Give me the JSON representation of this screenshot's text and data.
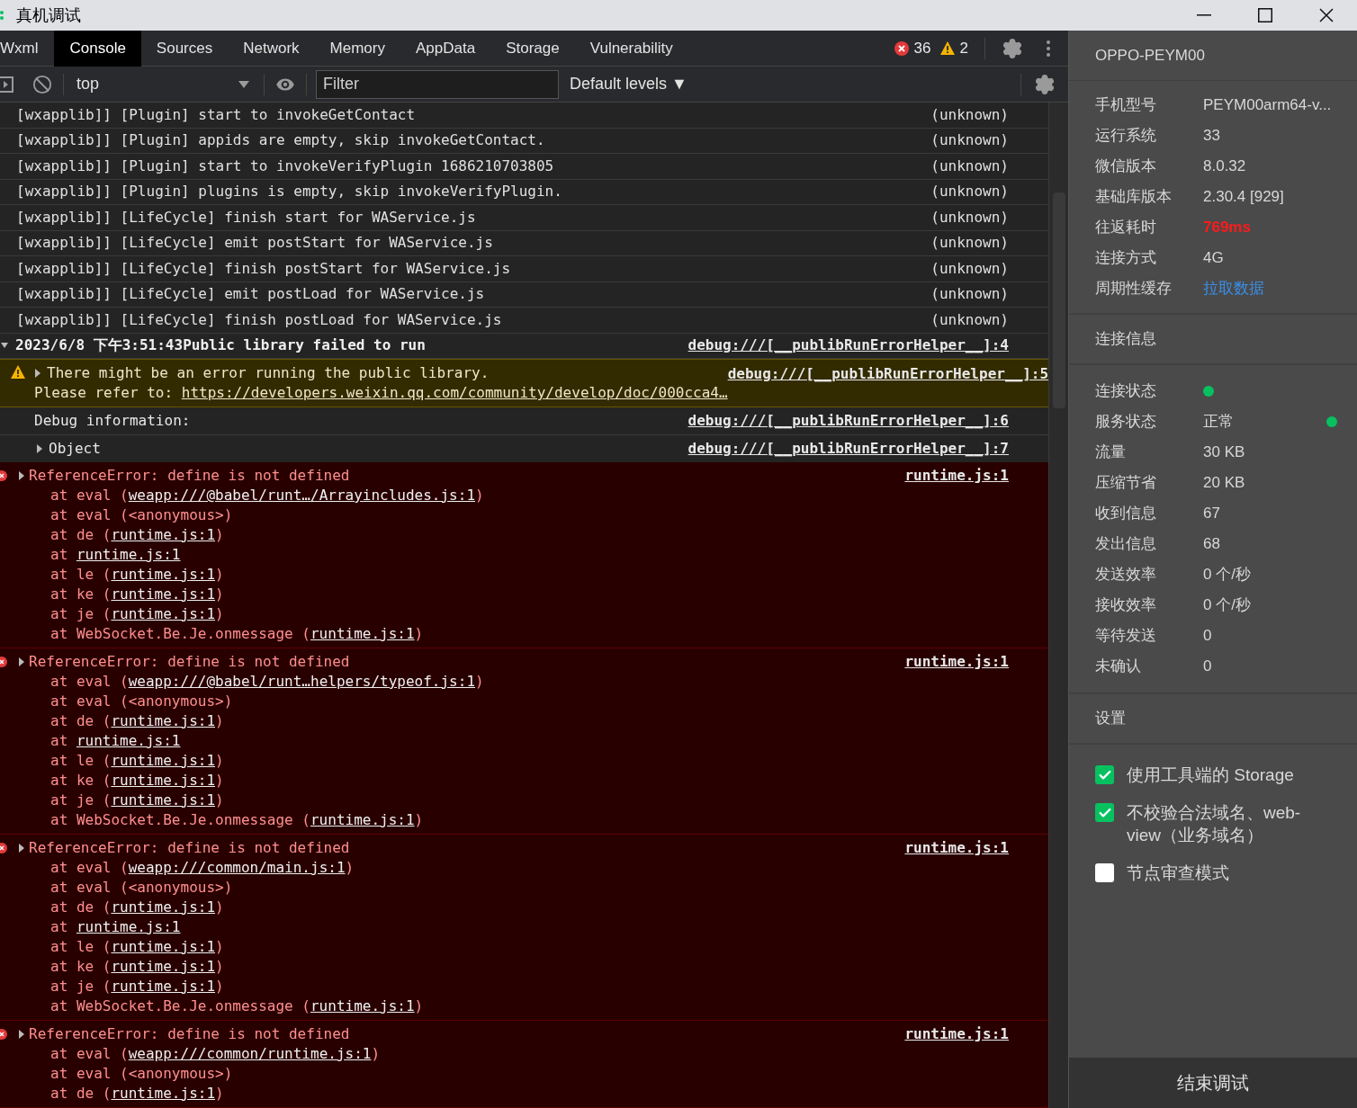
{
  "window": {
    "title": "真机调试"
  },
  "tabs": [
    {
      "label": "Wxml",
      "selected": false
    },
    {
      "label": "Console",
      "selected": true
    },
    {
      "label": "Sources",
      "selected": false
    },
    {
      "label": "Network",
      "selected": false
    },
    {
      "label": "Memory",
      "selected": false
    },
    {
      "label": "AppData",
      "selected": false
    },
    {
      "label": "Storage",
      "selected": false
    },
    {
      "label": "Vulnerability",
      "selected": false
    }
  ],
  "counts": {
    "errors": "36",
    "warnings": "2"
  },
  "console_toolbar": {
    "context": "top",
    "filter": {
      "placeholder": "Filter"
    },
    "levels": "Default levels",
    "levels_caret": "▼"
  },
  "logs": [
    {
      "kind": "plain",
      "text": "[wxapplib]] [Plugin] start to invokeGetContact",
      "source": "(unknown)"
    },
    {
      "kind": "plain",
      "text": "[wxapplib]] [Plugin] appids are empty, skip invokeGetContact.",
      "source": "(unknown)"
    },
    {
      "kind": "plain",
      "text": "[wxapplib]] [Plugin] start to invokeVerifyPlugin 1686210703805",
      "source": "(unknown)"
    },
    {
      "kind": "plain",
      "text": "[wxapplib]] [Plugin] plugins is empty, skip invokeVerifyPlugin.",
      "source": "(unknown)"
    },
    {
      "kind": "plain",
      "text": "[wxapplib]] [LifeCycle] finish start for WAService.js",
      "source": "(unknown)"
    },
    {
      "kind": "plain",
      "text": "[wxapplib]] [LifeCycle] emit postStart for WAService.js",
      "source": "(unknown)"
    },
    {
      "kind": "plain",
      "text": "[wxapplib]] [LifeCycle] finish postStart for WAService.js",
      "source": "(unknown)"
    },
    {
      "kind": "plain",
      "text": "[wxapplib]] [LifeCycle] emit postLoad for WAService.js",
      "source": "(unknown)"
    },
    {
      "kind": "plain",
      "text": "[wxapplib]] [LifeCycle] finish postLoad for WAService.js",
      "source": "(unknown)"
    },
    {
      "kind": "group",
      "text": "2023/6/8 下午3:51:43Public library failed to run",
      "source": "debug:///[__publibRunErrorHelper__]:4"
    },
    {
      "kind": "warning",
      "text": "There might be an error running the public library.",
      "prefix": "Please refer to: ",
      "link": "https://developers.weixin.qq.com/community/develop/doc/000cca4…",
      "source": "debug:///[__publibRunErrorHelper__]:5"
    },
    {
      "kind": "indent",
      "text": "Debug information:",
      "source": "debug:///[__publibRunErrorHelper__]:6"
    },
    {
      "kind": "object",
      "text": "Object",
      "source": "debug:///[__publibRunErrorHelper__]:7"
    }
  ],
  "errors": [
    {
      "message": "ReferenceError: define is not defined",
      "source": "runtime.js:1",
      "stack": [
        {
          "prefix": "at eval (",
          "link": "weapp:///@babel/runt…/Arrayincludes.js:1",
          "suffix": ")"
        },
        {
          "prefix": "at eval (<anonymous>)"
        },
        {
          "prefix": "at de (",
          "link": "runtime.js:1",
          "suffix": ")"
        },
        {
          "prefix": "at ",
          "link": "runtime.js:1"
        },
        {
          "prefix": "at le (",
          "link": "runtime.js:1",
          "suffix": ")"
        },
        {
          "prefix": "at ke (",
          "link": "runtime.js:1",
          "suffix": ")"
        },
        {
          "prefix": "at je (",
          "link": "runtime.js:1",
          "suffix": ")"
        },
        {
          "prefix": "at WebSocket.Be.Je.onmessage (",
          "link": "runtime.js:1",
          "suffix": ")"
        }
      ]
    },
    {
      "message": "ReferenceError: define is not defined",
      "source": "runtime.js:1",
      "stack": [
        {
          "prefix": "at eval (",
          "link": "weapp:///@babel/runt…helpers/typeof.js:1",
          "suffix": ")"
        },
        {
          "prefix": "at eval (<anonymous>)"
        },
        {
          "prefix": "at de (",
          "link": "runtime.js:1",
          "suffix": ")"
        },
        {
          "prefix": "at ",
          "link": "runtime.js:1"
        },
        {
          "prefix": "at le (",
          "link": "runtime.js:1",
          "suffix": ")"
        },
        {
          "prefix": "at ke (",
          "link": "runtime.js:1",
          "suffix": ")"
        },
        {
          "prefix": "at je (",
          "link": "runtime.js:1",
          "suffix": ")"
        },
        {
          "prefix": "at WebSocket.Be.Je.onmessage (",
          "link": "runtime.js:1",
          "suffix": ")"
        }
      ]
    },
    {
      "message": "ReferenceError: define is not defined",
      "source": "runtime.js:1",
      "stack": [
        {
          "prefix": "at eval (",
          "link": "weapp:///common/main.js:1",
          "suffix": ")"
        },
        {
          "prefix": "at eval (<anonymous>)"
        },
        {
          "prefix": "at de (",
          "link": "runtime.js:1",
          "suffix": ")"
        },
        {
          "prefix": "at ",
          "link": "runtime.js:1"
        },
        {
          "prefix": "at le (",
          "link": "runtime.js:1",
          "suffix": ")"
        },
        {
          "prefix": "at ke (",
          "link": "runtime.js:1",
          "suffix": ")"
        },
        {
          "prefix": "at je (",
          "link": "runtime.js:1",
          "suffix": ")"
        },
        {
          "prefix": "at WebSocket.Be.Je.onmessage (",
          "link": "runtime.js:1",
          "suffix": ")"
        }
      ]
    },
    {
      "message": "ReferenceError: define is not defined",
      "source": "runtime.js:1",
      "stack": [
        {
          "prefix": "at eval (",
          "link": "weapp:///common/runtime.js:1",
          "suffix": ")"
        },
        {
          "prefix": "at eval (<anonymous>)"
        },
        {
          "prefix": "at de (",
          "link": "runtime.js:1",
          "suffix": ")"
        }
      ]
    }
  ],
  "panel": {
    "device": "OPPO-PEYM00",
    "info": [
      {
        "label": "手机型号",
        "value": "PEYM00arm64-v...",
        "kind": "text"
      },
      {
        "label": "运行系统",
        "value": "33",
        "kind": "text"
      },
      {
        "label": "微信版本",
        "value": "8.0.32",
        "kind": "text"
      },
      {
        "label": "基础库版本",
        "value": "2.30.4 [929]",
        "kind": "text"
      },
      {
        "label": "往返耗时",
        "value": "769ms",
        "kind": "alert"
      },
      {
        "label": "连接方式",
        "value": "4G",
        "kind": "text"
      },
      {
        "label": "周期性缓存",
        "value": "拉取数据",
        "kind": "link"
      }
    ],
    "connection_title": "连接信息",
    "connection": [
      {
        "label": "连接状态",
        "kind": "dot",
        "color": "#07c160"
      },
      {
        "label": "服务状态",
        "value": "正常",
        "kind": "text_dot",
        "color": "#07c160"
      },
      {
        "label": "流量",
        "value": "30 KB",
        "kind": "text"
      },
      {
        "label": "压缩节省",
        "value": "20 KB",
        "kind": "text"
      },
      {
        "label": "收到信息",
        "value": "67",
        "kind": "text"
      },
      {
        "label": "发出信息",
        "value": "68",
        "kind": "text"
      },
      {
        "label": "发送效率",
        "value": "0 个/秒",
        "kind": "text"
      },
      {
        "label": "接收效率",
        "value": "0 个/秒",
        "kind": "text"
      },
      {
        "label": "等待发送",
        "value": "0",
        "kind": "text"
      },
      {
        "label": "未确认",
        "value": "0",
        "kind": "text"
      }
    ],
    "settings_title": "设置",
    "settings": [
      {
        "label": "使用工具端的 Storage",
        "checked": true
      },
      {
        "label": "不校验合法域名、web-view（业务域名）",
        "checked": true
      },
      {
        "label": "节点审查模式",
        "checked": false
      }
    ],
    "end_button": "结束调试"
  }
}
